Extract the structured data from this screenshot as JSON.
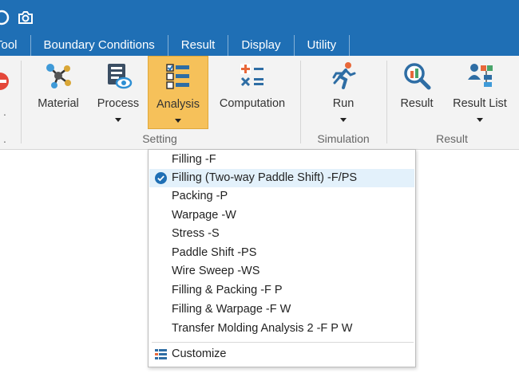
{
  "menu": {
    "tabs": [
      "Tool",
      "Boundary Conditions",
      "Result",
      "Display",
      "Utility"
    ]
  },
  "ribbon": {
    "buttons": {
      "material": "Material",
      "process": "Process",
      "analysis": "Analysis",
      "computation": "Computation",
      "run": "Run",
      "result": "Result",
      "result_list": "Result List"
    },
    "groups": {
      "setting": "Setting",
      "simulation": "Simulation",
      "result": "Result"
    }
  },
  "dropdown": {
    "items": [
      "Filling -F",
      "Filling (Two-way Paddle Shift) -F/PS",
      "Packing -P",
      "Warpage -W",
      "Stress -S",
      "Paddle Shift -PS",
      "Wire Sweep -WS",
      "Filling & Packing -F P",
      "Filling & Warpage -F W",
      "Transfer Molding Analysis 2 -F P W"
    ],
    "selected_index": 1,
    "customize": "Customize"
  },
  "colors": {
    "titlebar": "#1f6fb5",
    "active_button": "#f6c15a",
    "selected_row": "#e3f1fb",
    "check": "#1f6fb5"
  }
}
